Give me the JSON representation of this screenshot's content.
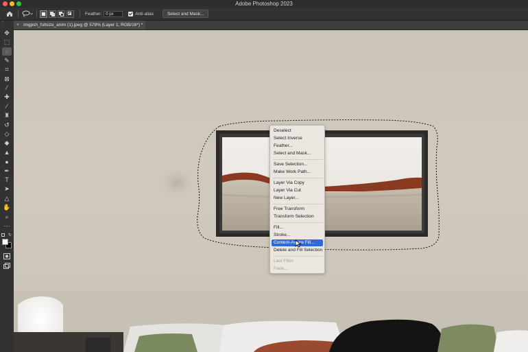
{
  "window": {
    "title": "Adobe Photoshop 2023",
    "traffic_colors": [
      "#fe5f57",
      "#febc2e",
      "#28c840"
    ]
  },
  "options_bar": {
    "feather_label": "Feather:",
    "feather_value": "0 px",
    "anti_alias_label": "Anti-alias",
    "anti_alias_checked": true,
    "select_and_mask_label": "Select and Mask..."
  },
  "document_tab": {
    "close_glyph": "×",
    "title": "imgpsh_fullsize_anim (1).jpeg @ 578% (Layer 1, RGB/16*) *"
  },
  "tools": [
    "move-icon",
    "marquee-icon",
    "lasso-icon",
    "quick-select-icon",
    "crop-icon",
    "frame-icon",
    "eyedropper-icon",
    "healing-icon",
    "brush-icon",
    "stamp-icon",
    "history-brush-icon",
    "eraser-icon",
    "paint-bucket-icon",
    "blur-icon",
    "dodge-icon",
    "pen-icon",
    "type-icon",
    "path-select-icon",
    "shape-icon",
    "hand-icon",
    "zoom-icon",
    "more-icon"
  ],
  "colors": {
    "accent": "#2f6bd8",
    "foreground_swatch": "#ffffff",
    "background_swatch": "#000000"
  },
  "context_menu": {
    "items": [
      {
        "label": "Deselect",
        "state": "normal"
      },
      {
        "label": "Select Inverse",
        "state": "normal"
      },
      {
        "label": "Feather...",
        "state": "normal"
      },
      {
        "label": "Select and Mask...",
        "state": "normal"
      },
      {
        "label": "Save Selection...",
        "state": "normal"
      },
      {
        "label": "Make Work Path...",
        "state": "normal"
      },
      {
        "label": "Layer Via Copy",
        "state": "normal"
      },
      {
        "label": "Layer Via Cut",
        "state": "normal"
      },
      {
        "label": "New Layer...",
        "state": "normal"
      },
      {
        "label": "Free Transform",
        "state": "normal"
      },
      {
        "label": "Transform Selection",
        "state": "normal"
      },
      {
        "label": "Fill...",
        "state": "normal"
      },
      {
        "label": "Stroke...",
        "state": "normal"
      },
      {
        "label": "Content-Aware Fill...",
        "state": "highlighted"
      },
      {
        "label": "Delete and Fill Selection",
        "state": "normal"
      },
      {
        "label": "Last Filter",
        "state": "disabled"
      },
      {
        "label": "Fade...",
        "state": "disabled"
      }
    ]
  }
}
